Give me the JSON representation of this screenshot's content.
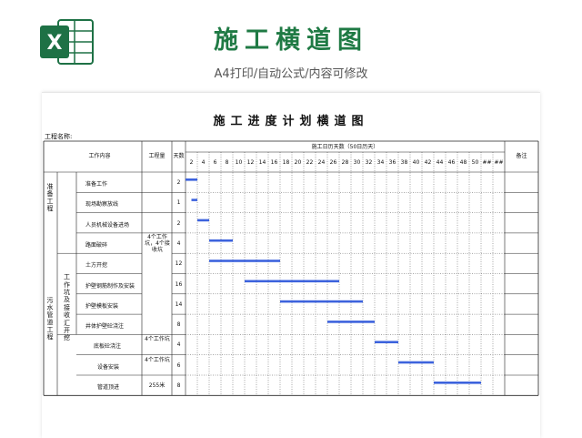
{
  "header": {
    "title": "施工横道图",
    "subtitle": "A4打印/自动公式/内容可修改"
  },
  "logo": {
    "icon": "excel-icon",
    "letter": "X",
    "color": "#1e7145"
  },
  "sheet": {
    "title": "施工进度计划横道图",
    "project_label": "工程名称:",
    "columns": {
      "content": "工作内容",
      "quantity": "工程量",
      "days": "天数",
      "calendar": "施工日历天数（50日历天）",
      "remark": "备注"
    },
    "day_ticks": [
      "2",
      "4",
      "6",
      "8",
      "10",
      "12",
      "14",
      "16",
      "18",
      "20",
      "22",
      "24",
      "26",
      "28",
      "30",
      "32",
      "34",
      "36",
      "38",
      "40",
      "42",
      "44",
      "46",
      "48",
      "50",
      "##",
      "##"
    ],
    "groups": {
      "prep": "准备工程",
      "sewer": "污水管道工程",
      "excavation": "工作坑及接收汇开挖"
    },
    "quantity_notes": {
      "pits": "4个工作坑，4个接收坑",
      "pit_single": "4个工作坑",
      "pipe": "255米"
    },
    "tasks": [
      {
        "name": "准备工作",
        "days": "2",
        "start": 0,
        "end": 2
      },
      {
        "name": "现场勘察放线",
        "days": "1",
        "start": 1,
        "end": 2
      },
      {
        "name": "人员机械设备进场",
        "days": "2",
        "start": 2,
        "end": 4
      },
      {
        "name": "路面破碎",
        "days": "4",
        "start": 4,
        "end": 8
      },
      {
        "name": "土方开挖",
        "days": "12",
        "start": 4,
        "end": 16
      },
      {
        "name": "护壁钢筋制作及安装",
        "days": "16",
        "start": 10,
        "end": 26
      },
      {
        "name": "护壁模板安装",
        "days": "14",
        "start": 16,
        "end": 30
      },
      {
        "name": "井体护壁砼浇注",
        "days": "8",
        "start": 24,
        "end": 32
      },
      {
        "name": "底板砼浇注",
        "days": "4",
        "start": 32,
        "end": 36
      },
      {
        "name": "设备安装",
        "days": "6",
        "start": 36,
        "end": 42
      },
      {
        "name": "管道顶进",
        "days": "8",
        "start": 42,
        "end": 50
      }
    ]
  },
  "colors": {
    "brand": "#1f7a44",
    "bar": "#3d63dd",
    "grid": "#222222"
  }
}
